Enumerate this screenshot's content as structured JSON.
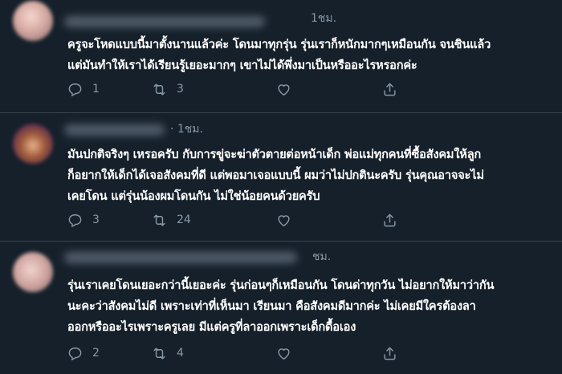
{
  "tweets": [
    {
      "time": "1ชม.",
      "lines": [
        "ครูจะโหดแบบนี้มาตั้งนานแล้วค่ะ โดนมาทุกรุ่น รุ่นเราก็หนักมากๆเหมือนกัน จนชินแล้ว",
        "แต่มันทำให้เราได้เรียนรู้เยอะมากๆ เขาไม่ได้พึ่งมาเป็นหรืออะไรหรอกค่ะ"
      ],
      "replies": "1",
      "retweets": "3",
      "likes": ""
    },
    {
      "time": "· 1ชม.",
      "lines": [
        "มันปกติจริงๆ เหรอครับ กับการขู่จะฆ่าตัวตายต่อหน้าเด็ก พ่อแม่ทุกคนที่ซื้อสังคมให้ลูก",
        "ก็อยากให้เด็กได้เจอสังคมที่ดี แต่พอมาเจอแบบนี้ ผมว่าไม่ปกตินะครับ รุ่นคุณอาจจะไม่",
        "เคยโดน แต่รุ่นน้องผมโดนกัน ไม่ใช่น้อยคนด้วยครับ"
      ],
      "replies": "3",
      "retweets": "24",
      "likes": ""
    },
    {
      "time": "ชม.",
      "lines": [
        "รุ่นเราเคยโดนเยอะกว่านี้เยอะค่ะ รุ่นก่อนๆก็เหมือนกัน โดนด่าทุกวัน ไม่อยากให้มาว่ากัน",
        "นะคะว่าสังคมไม่ดี เพราะเท่าที่เห็นมา เรียนมา คือสังคมดีมากค่ะ ไม่เคยมีใครต้องลา",
        "ออกหรืออะไรเพราะครูเลย มีแต่ครูที่ลาออกเพราะเด็กดื้อเอง"
      ],
      "replies": "2",
      "retweets": "4",
      "likes": ""
    }
  ],
  "icons": {
    "reply": "reply-icon",
    "retweet": "retweet-icon",
    "like": "heart-icon",
    "share": "share-icon"
  },
  "colors": {
    "background": "#15202b",
    "text": "#ffffff",
    "secondary_text": "#8899a6",
    "divider": "#38444d"
  }
}
